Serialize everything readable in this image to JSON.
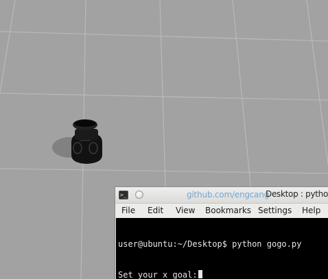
{
  "scene": {
    "floor_color": "#a2a2a2",
    "grid_color": "#b8b8b8",
    "robot_color": "#111111",
    "shadow_color": "#7b7b7b"
  },
  "terminal": {
    "watermark": "github.com/engcang",
    "title": "Desktop : python",
    "menu": {
      "file": "File",
      "edit": "Edit",
      "view": "View",
      "bookmarks": "Bookmarks",
      "settings": "Settings",
      "help": "Help"
    },
    "console": {
      "line1": "user@ubuntu:~/Desktop$ python gogo.py",
      "line2": "Set your x goal:"
    },
    "background_color": "#000000",
    "text_color": "#e6e6e6",
    "watermark_color": "#6fa6d6"
  }
}
